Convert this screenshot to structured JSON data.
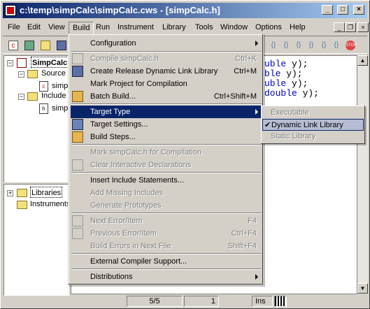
{
  "window": {
    "title": "c:\\temp\\simpCalc\\simpCalc.cws - [simpCalc.h]",
    "controls": {
      "minimize": "_",
      "maximize": "□",
      "close": "×"
    },
    "mdi_controls": {
      "minimize": "_",
      "restore": "❐",
      "close": "×"
    }
  },
  "menubar": {
    "items": [
      "File",
      "Edit",
      "View",
      "Build",
      "Run",
      "Instrument",
      "Library",
      "Tools",
      "Window",
      "Options",
      "Help"
    ],
    "active": "Build"
  },
  "tree": {
    "project": "SimpCalc",
    "source_folder": "Source",
    "source_file": "simp",
    "source_file_icon": "c",
    "include_folder": "Include",
    "include_file": "simp",
    "include_file_icon": "h",
    "libraries": "Libraries",
    "instruments": "Instruments"
  },
  "code": {
    "lines": [
      {
        "kw": "uble",
        "rest": " y);"
      },
      {
        "kw": "ble",
        "rest": " y);"
      },
      {
        "kw": "uble",
        "rest": " y);"
      },
      {
        "kw": "double",
        "rest": " y);"
      }
    ]
  },
  "build_menu": {
    "items": [
      {
        "label": "Configuration",
        "submenu": true
      },
      {
        "label": "Compile simpCalc.h",
        "shortcut": "Ctrl+K",
        "disabled": true
      },
      {
        "label": "Create Release Dynamic Link Library",
        "shortcut": "Ctrl+M"
      },
      {
        "label": "Mark Project for Compilation"
      },
      {
        "label": "Batch Build...",
        "shortcut": "Ctrl+Shift+M"
      },
      {
        "label": "Target Type",
        "submenu": true,
        "selected": true
      },
      {
        "label": "Target Settings..."
      },
      {
        "label": "Build Steps..."
      },
      {
        "label": "Mark simpCalc.h for Compilation",
        "disabled": true
      },
      {
        "label": "Clear Interactive Declarations",
        "disabled": true
      },
      {
        "label": "Insert Include Statements..."
      },
      {
        "label": "Add Missing Includes",
        "disabled": true
      },
      {
        "label": "Generate Prototypes",
        "disabled": true
      },
      {
        "label": "Next Error/Item",
        "shortcut": "F4",
        "disabled": true
      },
      {
        "label": "Previous Error/Item",
        "shortcut": "Ctrl+F4",
        "disabled": true
      },
      {
        "label": "Build Errors in Next File",
        "shortcut": "Shift+F4",
        "disabled": true
      },
      {
        "label": "External Compiler Support..."
      },
      {
        "label": "Distributions",
        "submenu": true
      }
    ]
  },
  "target_type_submenu": {
    "items": [
      {
        "label": "Executable",
        "disabled": true
      },
      {
        "label": "Dynamic Link Library",
        "checked": true
      },
      {
        "label": "Static Library",
        "disabled": true
      }
    ],
    "check_glyph": "✔"
  },
  "status": {
    "position": "5/5",
    "column": "1",
    "mode": "Ins"
  }
}
